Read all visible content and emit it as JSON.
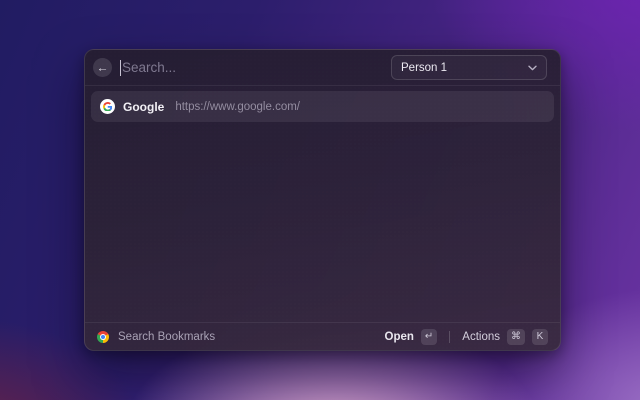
{
  "window": {
    "search": {
      "value": "",
      "placeholder": "Search..."
    },
    "profile_dropdown": {
      "selected": "Person 1"
    },
    "results": [
      {
        "title": "Google",
        "url": "https://www.google.com/",
        "selected": true,
        "icon": "google-logo"
      }
    ],
    "footer": {
      "source_label": "Search Bookmarks",
      "source_icon": "chrome-icon",
      "primary_action": {
        "label": "Open",
        "key": "↵"
      },
      "secondary_action": {
        "label": "Actions",
        "keys": [
          "⌘",
          "K"
        ]
      }
    }
  },
  "icons": {
    "back": "←"
  },
  "colors": {
    "google-blue": "#4285F4",
    "google-red": "#EA4335",
    "google-yellow": "#FBBC05",
    "google-green": "#34A853",
    "bg-top-left": "#211c62",
    "bg-top-right": "#6f23b4",
    "bg-bottom-pink": "#dcaad0",
    "bg-bottom-left": "#6b2347",
    "bg-bottom-right": "#9a6fc4"
  }
}
